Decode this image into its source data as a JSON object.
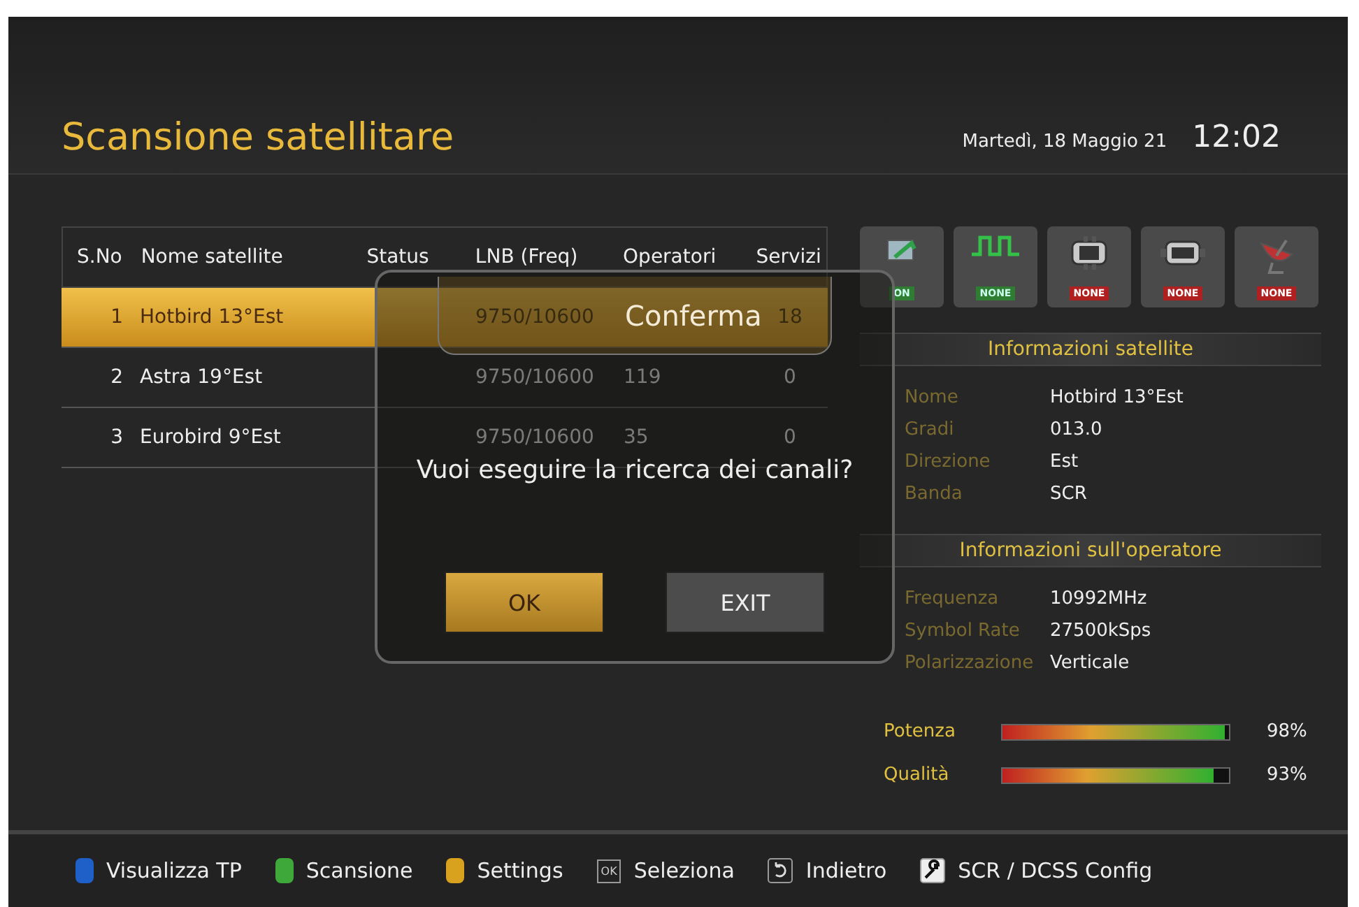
{
  "screen": {
    "title": "Scansione satellitare",
    "date": "Martedì, 18 Maggio 21",
    "time": "12:02"
  },
  "table": {
    "columns": [
      "S.No",
      "Nome satellite",
      "Status",
      "LNB (Freq)",
      "Operatori",
      "Servizi"
    ],
    "rows": [
      {
        "number": "1",
        "name": "Hotbird 13°Est",
        "lnb": "9750/10600",
        "services": "18",
        "selected": true
      },
      {
        "number": "2",
        "name": "Astra 19°Est",
        "lnb": "9750/10600",
        "operators": "119",
        "services": "0",
        "selected": false
      },
      {
        "number": "3",
        "name": "Eurobird 9°Est",
        "lnb": "9750/10600",
        "operators": "35",
        "services": "0",
        "selected": false
      }
    ]
  },
  "devices": [
    {
      "kind": "tuner",
      "status": "ON",
      "active": true
    },
    {
      "kind": "pulse",
      "status": "NONE",
      "active": true
    },
    {
      "kind": "tb-switch",
      "status": "NONE",
      "active": false
    },
    {
      "kind": "diseqc",
      "status": "NONE",
      "active": false
    },
    {
      "kind": "dish",
      "status": "NONE",
      "active": false
    }
  ],
  "satellite_info": {
    "title": "Informazioni satellite",
    "fields": [
      {
        "label": "Nome",
        "value": "Hotbird 13°Est"
      },
      {
        "label": "Gradi",
        "value": "013.0"
      },
      {
        "label": "Direzione",
        "value": "Est"
      },
      {
        "label": "Banda",
        "value": "SCR"
      }
    ]
  },
  "operator_info": {
    "title": "Informazioni sull'operatore",
    "fields": [
      {
        "label": "Frequenza",
        "value": "10992MHz"
      },
      {
        "label": "Symbol Rate",
        "value": "27500kSps"
      },
      {
        "label": "Polarizzazione",
        "value": "Verticale"
      }
    ]
  },
  "meters": [
    {
      "label": "Potenza",
      "level": 0.98,
      "reading": "98%"
    },
    {
      "label": "Qualità",
      "level": 0.93,
      "reading": "93%"
    }
  ],
  "dialog": {
    "title": "Conferma",
    "message": "Vuoi eseguire la ricerca dei canali?",
    "buttons": [
      {
        "label": "OK",
        "selected": true
      },
      {
        "label": "EXIT",
        "selected": false
      }
    ]
  },
  "footer": [
    {
      "kind": "color",
      "color": "#1f5fc8",
      "label": "Visualizza TP"
    },
    {
      "kind": "color",
      "color": "#3fa83a",
      "label": "Scansione"
    },
    {
      "kind": "color",
      "color": "#d9a21e",
      "label": "Settings"
    },
    {
      "kind": "key",
      "key": "OK",
      "label": "Seleziona"
    },
    {
      "kind": "back",
      "label": "Indietro"
    },
    {
      "kind": "wrench",
      "label": "SCR / DCSS Config"
    }
  ]
}
